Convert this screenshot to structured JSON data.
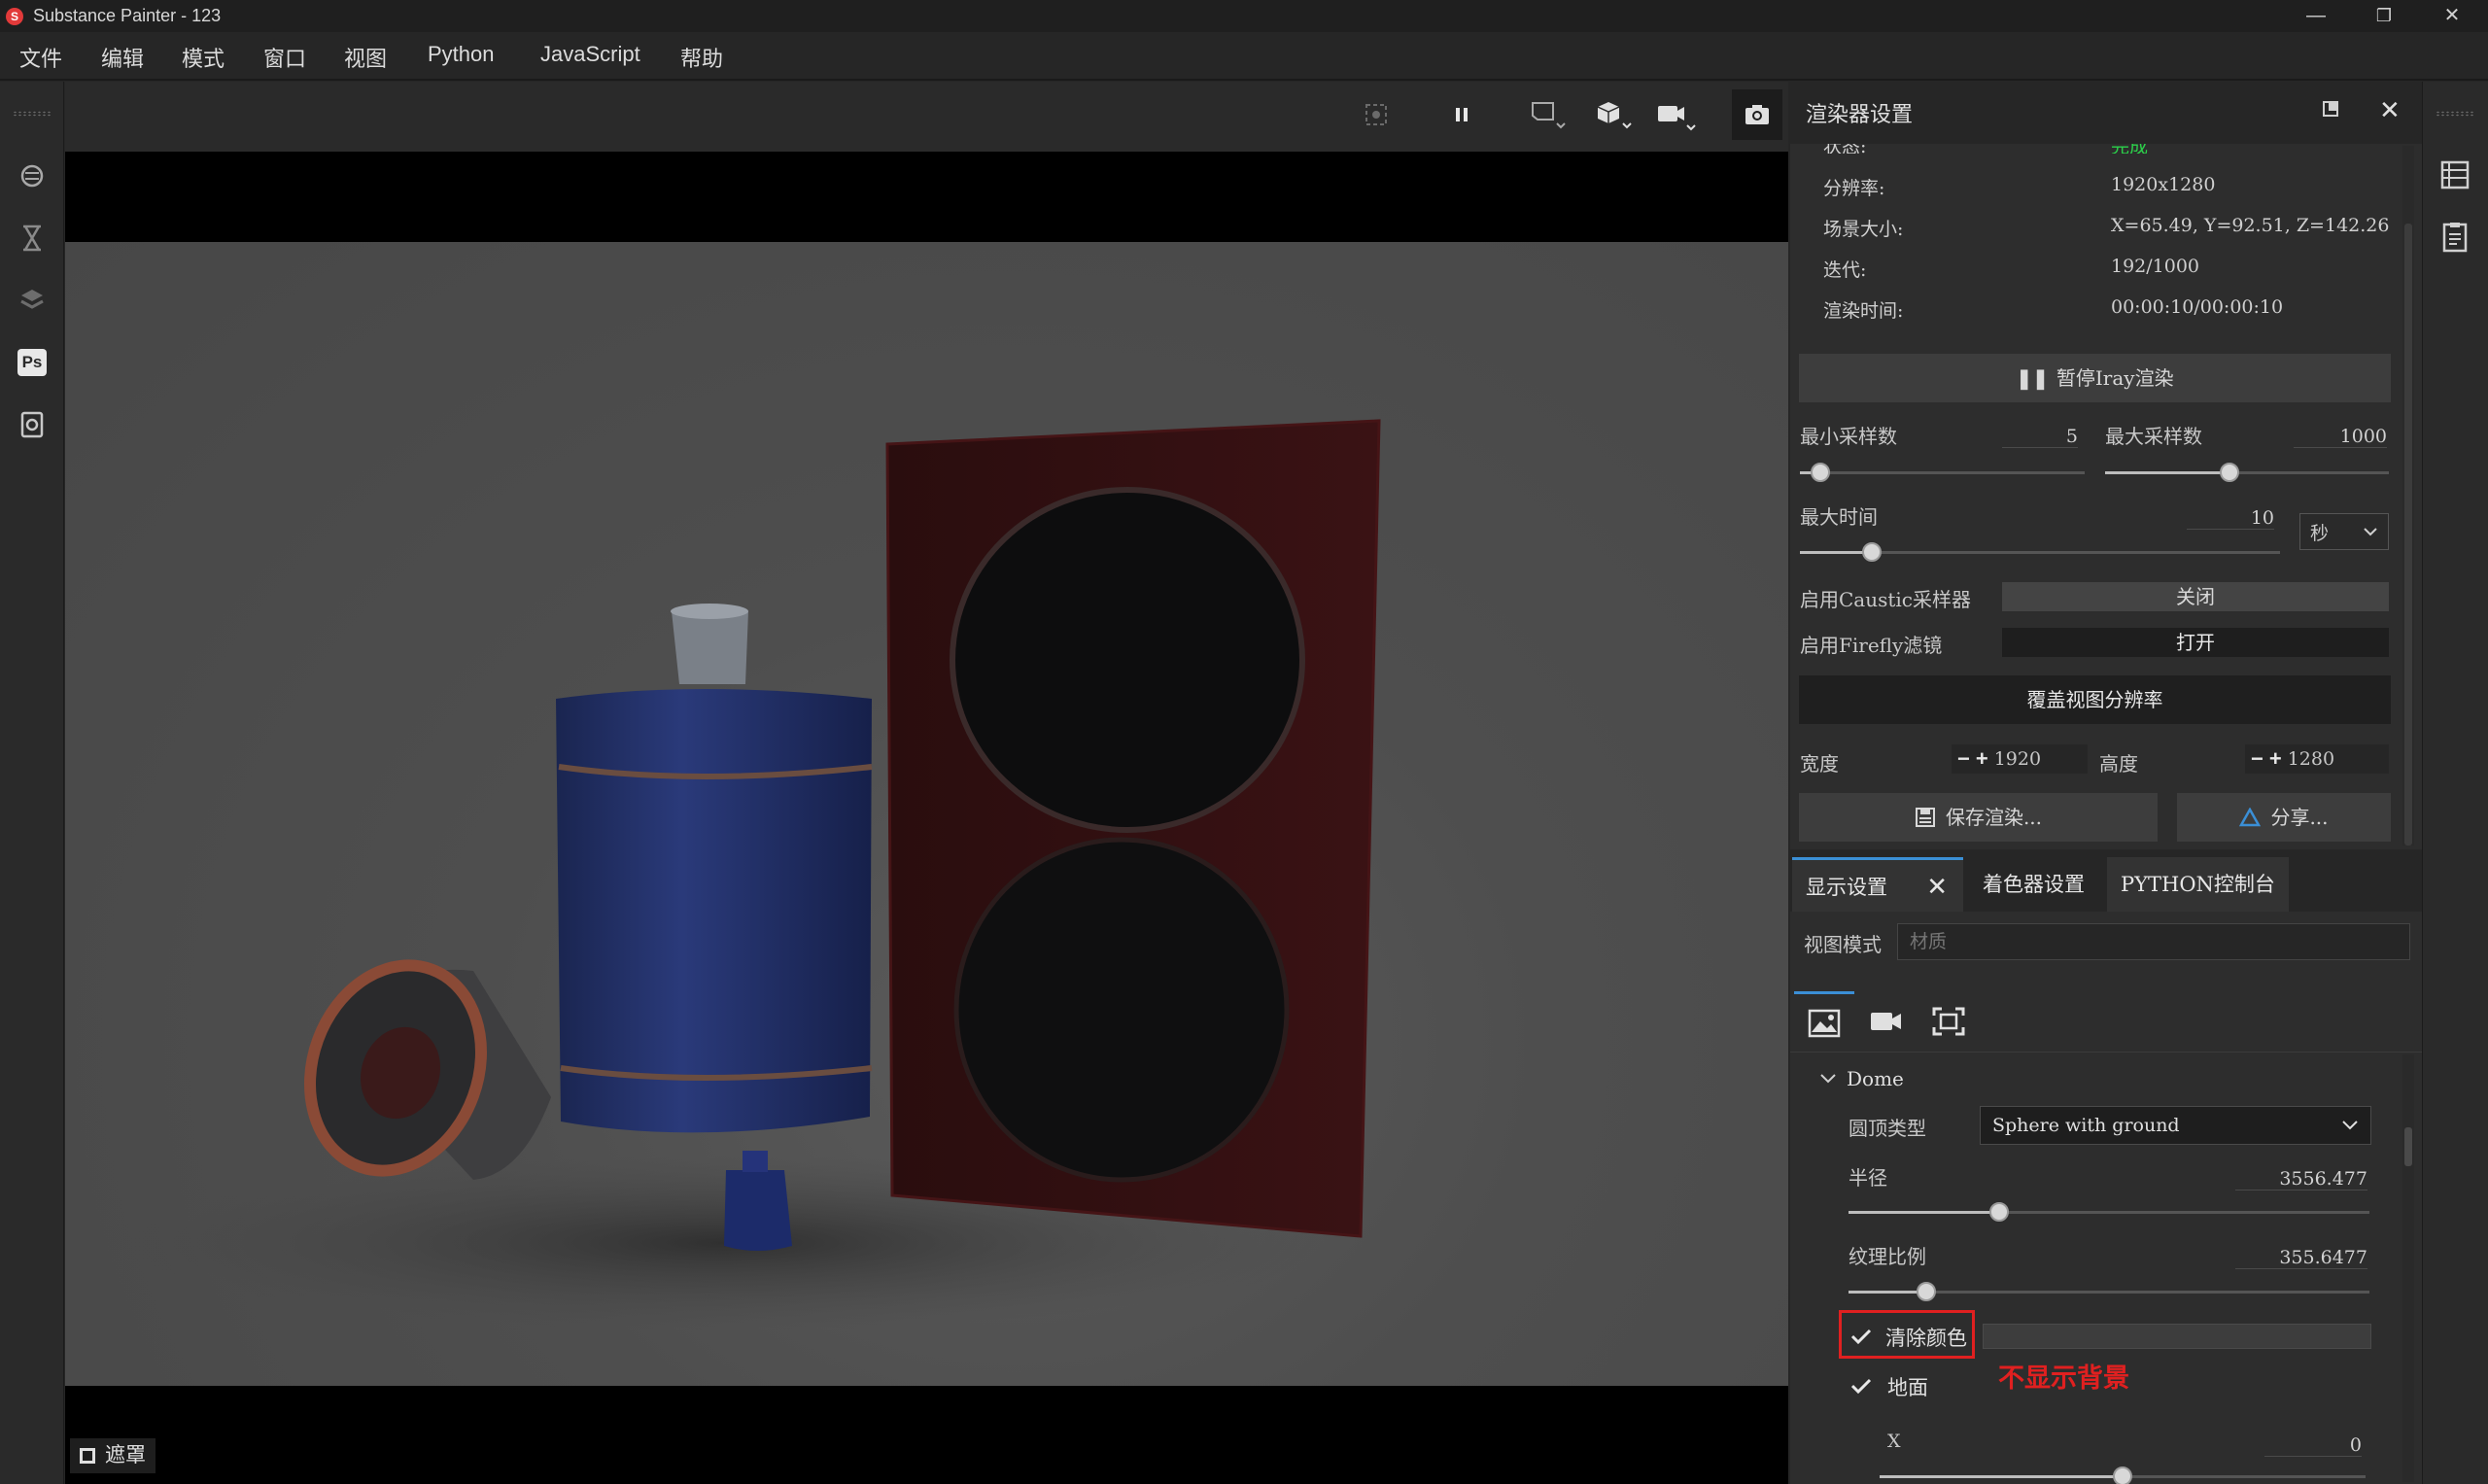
{
  "window": {
    "title": "Substance Painter - 123",
    "logo": "S",
    "minimize": "—",
    "restore": "❐",
    "close": "✕"
  },
  "menu": [
    "文件",
    "编辑",
    "模式",
    "窗口",
    "视图",
    "Python",
    "JavaScript",
    "帮助"
  ],
  "left_toolbar_icons": [
    "iray-icon",
    "hourglass-icon",
    "substance-share-icon",
    "photoshop-icon",
    "sync-icon"
  ],
  "ps_label": "Ps",
  "viewport": {
    "mask_label": "遮罩"
  },
  "renderer": {
    "title": "渲染器设置",
    "status_label": "状态:",
    "status_value": "完成",
    "resolution_label": "分辨率:",
    "resolution_value": "1920x1280",
    "scene_size_label": "场景大小:",
    "scene_size_value": "X=65.49, Y=92.51, Z=142.26",
    "iterations_label": "迭代:",
    "iterations_value": "192/1000",
    "render_time_label": "渲染时间:",
    "render_time_value": "00:00:10/00:00:10",
    "pause_button": "暂停Iray渲染",
    "min_samples_label": "最小采样数",
    "min_samples_value": "5",
    "min_samples_level": 0.07,
    "max_samples_label": "最大采样数",
    "max_samples_value": "1000",
    "max_samples_level": 0.44,
    "max_time_label": "最大时间",
    "max_time_value": "10",
    "max_time_level": 0.15,
    "time_unit": "秒",
    "caustic_label": "启用Caustic采样器",
    "caustic_value": "关闭",
    "firefly_label": "启用Firefly滤镜",
    "firefly_value": "打开",
    "override_resolution": "覆盖视图分辨率",
    "width_label": "宽度",
    "width_value": "1920",
    "height_label": "高度",
    "height_value": "1280",
    "save_render": "保存渲染...",
    "share": "分享..."
  },
  "display": {
    "tabs": [
      "显示设置",
      "着色器设置",
      "PYTHON控制台"
    ],
    "view_mode_label": "视图模式",
    "view_mode_placeholder": "材质",
    "dome_section": "Dome",
    "dome_type_label": "圆顶类型",
    "dome_type_value": "Sphere with ground",
    "radius_label": "半径",
    "radius_value": "3556.477",
    "radius_level": 0.29,
    "texture_scale_label": "纹理比例",
    "texture_scale_value": "355.6477",
    "texture_scale_level": 0.15,
    "clear_color_label": "清除颜色",
    "clear_color_checked": true,
    "annotation": "不显示背景",
    "ground_label": "地面",
    "ground_checked": true,
    "x_label": "X",
    "x_value": "0",
    "x_level": 0.5
  },
  "colors": {
    "accent": "#3b8fd6",
    "status_ok": "#2bd14a",
    "annotation_red": "#e02020"
  }
}
